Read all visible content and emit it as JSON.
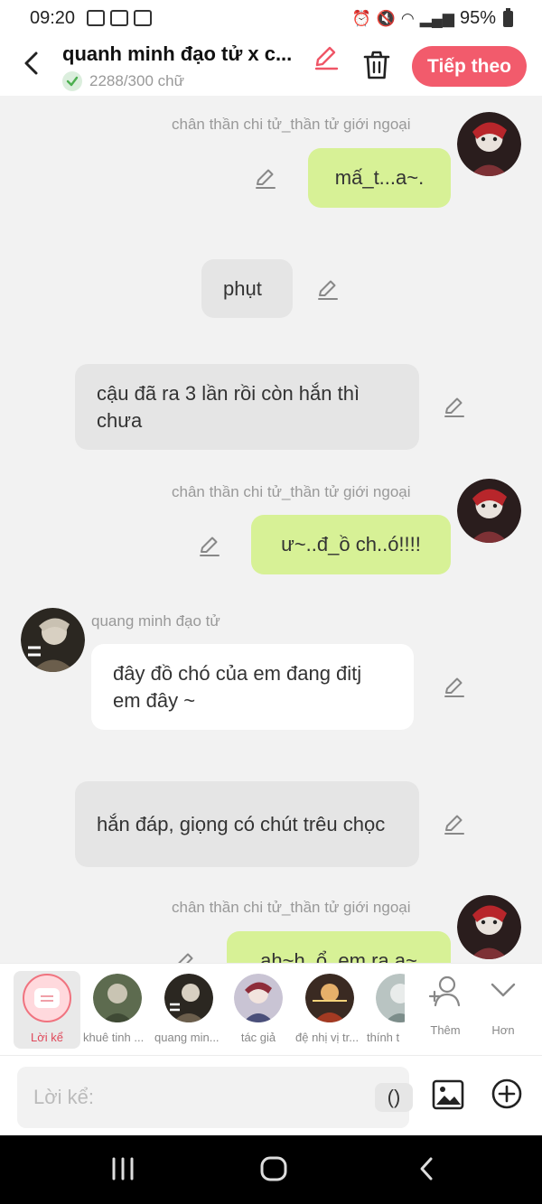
{
  "status_bar": {
    "time": "09:20",
    "battery": "95%"
  },
  "header": {
    "title": "quanh minh đạo tử x c...",
    "word_count": "2288/300 chữ",
    "next_label": "Tiếp theo",
    "accent_color": "#f25b6c"
  },
  "messages": [
    {
      "sender": "chân thần chi tử_thần tử giới ngoại",
      "text": "mấ_t...a~."
    },
    {
      "text": "phụt"
    },
    {
      "text": "cậu đã ra 3 lần rồi còn hắn thì chưa"
    },
    {
      "sender": "chân thần chi tử_thần tử giới ngoại",
      "text": "ư~..đ_ồ ch..ó!!!!"
    },
    {
      "sender": "quang minh đạo tử",
      "text": "đây đồ chó của em đang đitj em đây ~"
    },
    {
      "text": "hắn đáp, giọng có chút trêu chọc"
    },
    {
      "sender": "chân thần chi tử_thần tử giới ngoại",
      "text": "ah~h..ổ..em ra a~"
    }
  ],
  "characters": {
    "narrator_label": "Lời kể",
    "items": [
      {
        "label": "khuê tinh ..."
      },
      {
        "label": "quang min..."
      },
      {
        "label": "tác giả"
      },
      {
        "label": "đệ nhị vị tr..."
      },
      {
        "label": "thính t"
      }
    ],
    "add_label": "Thêm",
    "more_label": "Hơn"
  },
  "input": {
    "placeholder": "Lời kể:",
    "paren_label": "()"
  },
  "colors": {
    "user_bubble": "#d7f196",
    "narration_bubble": "#e5e5e5",
    "character_bubble": "#ffffff"
  }
}
